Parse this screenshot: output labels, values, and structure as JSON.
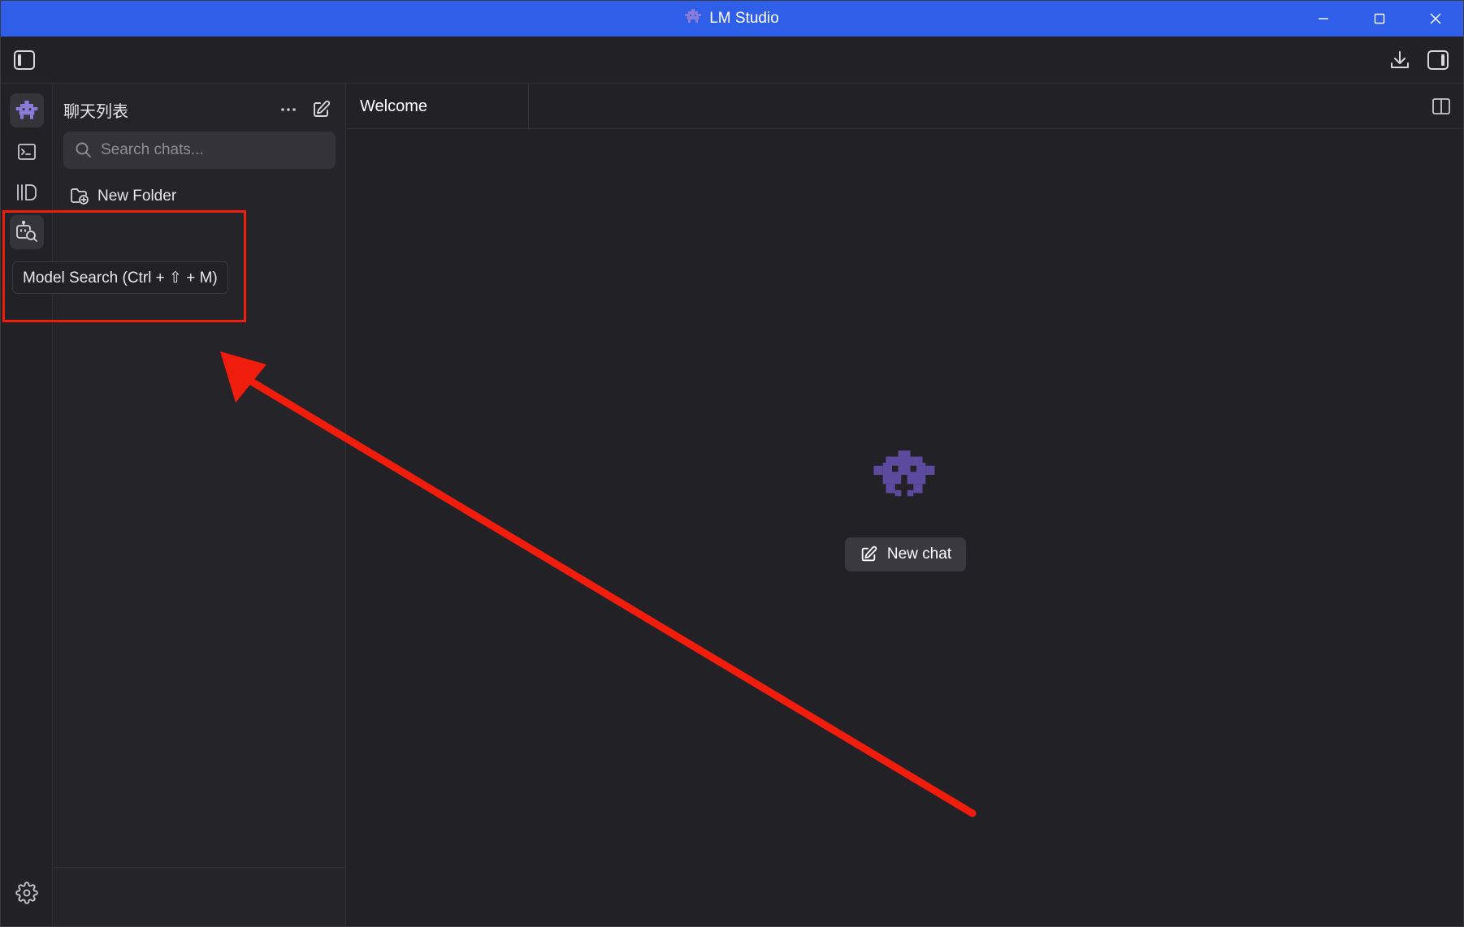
{
  "window": {
    "title": "LM Studio",
    "brand_color": "#2f5ee8",
    "controls": [
      "minimize-icon",
      "maximize-icon",
      "close-icon"
    ]
  },
  "toolbar": {
    "left_icon": "sidebar-toggle-icon",
    "right_icons": [
      "download-icon",
      "right-panel-icon"
    ]
  },
  "rail": {
    "items": [
      {
        "name": "chat",
        "icon": "robot-icon",
        "active": false
      },
      {
        "name": "developer",
        "icon": "terminal-icon",
        "active": false
      },
      {
        "name": "my-models",
        "icon": "library-icon",
        "active": false
      },
      {
        "name": "discover",
        "icon": "model-search-icon",
        "active": true
      }
    ],
    "bottom_icon": "gear-icon"
  },
  "tooltip": {
    "text": "Model Search (Ctrl + ⇧ + M)"
  },
  "chat_list": {
    "title": "聊天列表",
    "more_icon": "ellipsis-icon",
    "compose_icon": "compose-icon",
    "search_placeholder": "Search chats...",
    "new_folder_label": "New Folder"
  },
  "main": {
    "tab_label": "Welcome",
    "split_icon": "split-view-icon",
    "new_chat_label": "New chat",
    "logo_color": "#5b4a9e"
  },
  "annotation": {
    "color": "#f01c0c"
  }
}
